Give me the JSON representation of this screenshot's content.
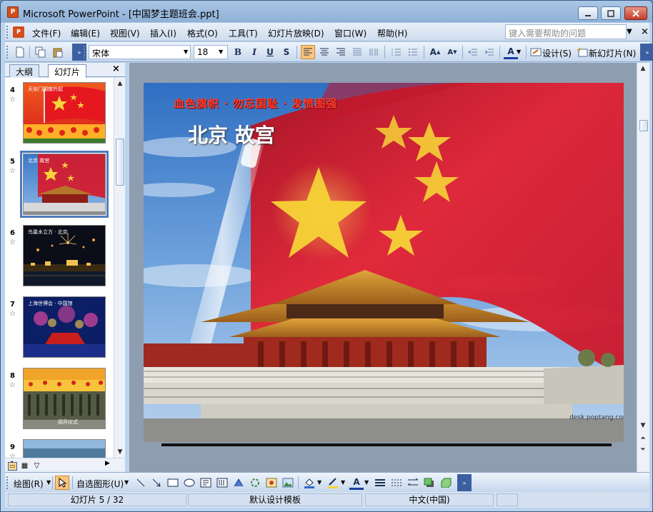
{
  "window": {
    "title": "Microsoft PowerPoint - [中国梦主题班会.ppt]",
    "app_icon": "powerpoint-icon"
  },
  "menu": {
    "items": [
      "文件(F)",
      "编辑(E)",
      "视图(V)",
      "插入(I)",
      "格式(O)",
      "工具(T)",
      "幻灯片放映(D)",
      "窗口(W)",
      "帮助(H)"
    ],
    "help_placeholder": "键入需要帮助的问题"
  },
  "toolbar": {
    "font_name": "宋体",
    "font_size": "18",
    "bold": "B",
    "italic": "I",
    "underline": "U",
    "shadow": "S",
    "design_label": "设计(S)",
    "new_slide_label": "新幻灯片(N)",
    "font_color_glyph": "A"
  },
  "left_pane": {
    "tabs": [
      "大纲",
      "幻灯片"
    ],
    "selected_tab": "幻灯片",
    "thumbnails": [
      {
        "num": "4",
        "caption": "天安门国旗升起",
        "theme": "flag-ceremony"
      },
      {
        "num": "5",
        "caption": "北京 故宫",
        "theme": "forbidden-city",
        "selected": true
      },
      {
        "num": "6",
        "caption": "鸟巢水立方 · 北京",
        "theme": "fireworks-night"
      },
      {
        "num": "7",
        "caption": "上海世博会 · 中国馆",
        "theme": "expo-night"
      },
      {
        "num": "8",
        "caption": "阅兵仪式",
        "theme": "parade"
      },
      {
        "num": "9",
        "caption": "",
        "theme": "city-skyline"
      }
    ]
  },
  "slide": {
    "tagline": "血色旗帜 · 勿忘国耻 · 发愤图强",
    "title": "北京 故宫",
    "watermark": "desk.poptang.com"
  },
  "drawbar": {
    "draw_label": "绘图(R)",
    "autoshapes_label": "自选图形(U)"
  },
  "status": {
    "slide_position": "幻灯片 5 / 32",
    "template": "默认设计模板",
    "language": "中文(中国)"
  },
  "colors": {
    "flag_red": "#d7192a",
    "star_yellow": "#f6d83c",
    "selection_blue": "#4f7bbd",
    "toolbar_active": "#ffc47a"
  }
}
